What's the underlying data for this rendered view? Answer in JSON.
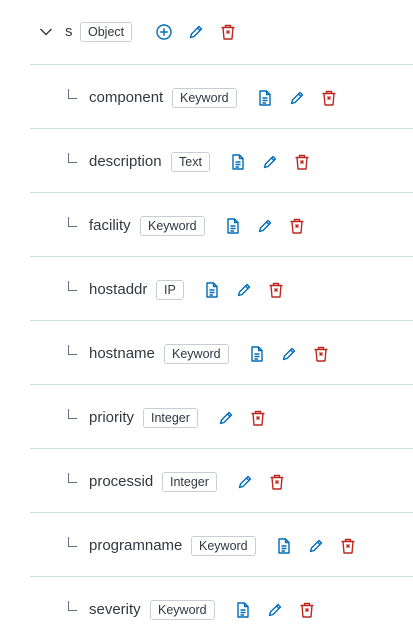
{
  "root": {
    "name": "s",
    "type": "Object"
  },
  "fields": [
    {
      "name": "component",
      "type": "Keyword",
      "has_doc": true
    },
    {
      "name": "description",
      "type": "Text",
      "has_doc": true
    },
    {
      "name": "facility",
      "type": "Keyword",
      "has_doc": true
    },
    {
      "name": "hostaddr",
      "type": "IP",
      "has_doc": true
    },
    {
      "name": "hostname",
      "type": "Keyword",
      "has_doc": true
    },
    {
      "name": "priority",
      "type": "Integer",
      "has_doc": false
    },
    {
      "name": "processid",
      "type": "Integer",
      "has_doc": false
    },
    {
      "name": "programname",
      "type": "Keyword",
      "has_doc": true
    },
    {
      "name": "severity",
      "type": "Keyword",
      "has_doc": true
    }
  ],
  "colors": {
    "accent": "#006bb8",
    "danger": "#bd271e",
    "border": "#d3dae6",
    "text": "#343741"
  },
  "icons": [
    "chevron-down-icon",
    "add-icon",
    "edit-icon",
    "delete-icon",
    "document-icon",
    "tree-elbow-icon"
  ]
}
